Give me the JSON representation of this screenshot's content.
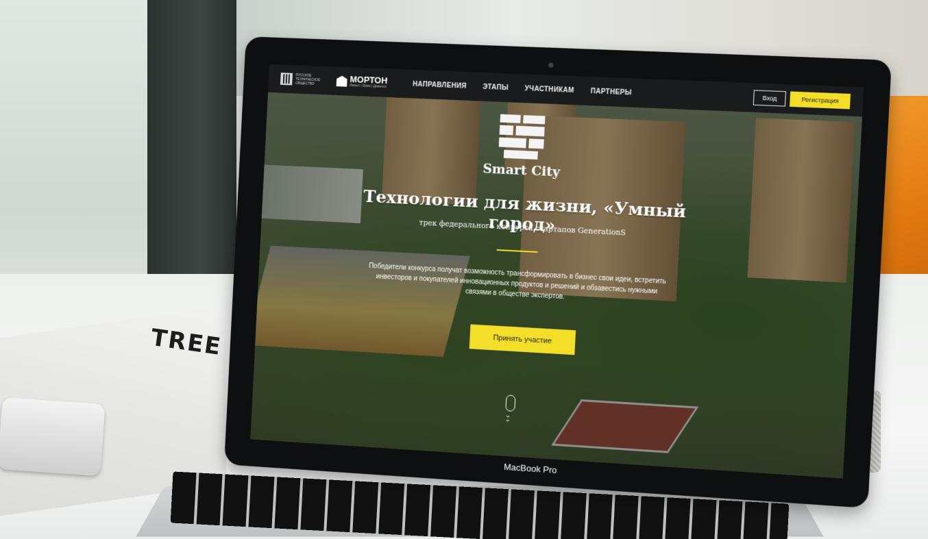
{
  "laptop": {
    "brand": "MacBook Pro"
  },
  "magazine": {
    "title": "TREE"
  },
  "site": {
    "logos": {
      "rto_text": "РУССКОЕ ТЕХНИЧЕСКОЕ ОБЩЕСТВО",
      "morton_text": "МОРТОН",
      "morton_sub": "Инвест | Банк | Девелоп"
    },
    "nav": {
      "links": [
        "НАПРАВЛЕНИЯ",
        "ЭТАПЫ",
        "УЧАСТНИКАМ",
        "ПАРТНЕРЫ"
      ],
      "login_label": "Вход",
      "register_label": "Регистрация"
    },
    "hero": {
      "brand": "Smart City",
      "title": "Технологии для жизни, «Умный город»",
      "subtitle": "трек федерального конкурса стартапов GenerationS",
      "description": "Победители конкурса получат возможность трансформировать в бизнес свои идеи, встретить инвесторов и покупателей инновационных продуктов и решений и обзавестись нужными связями в обществе экспертов.",
      "cta_label": "Принять участие"
    },
    "colors": {
      "accent": "#f3df2a",
      "navbar": "#1a1b1c"
    }
  }
}
